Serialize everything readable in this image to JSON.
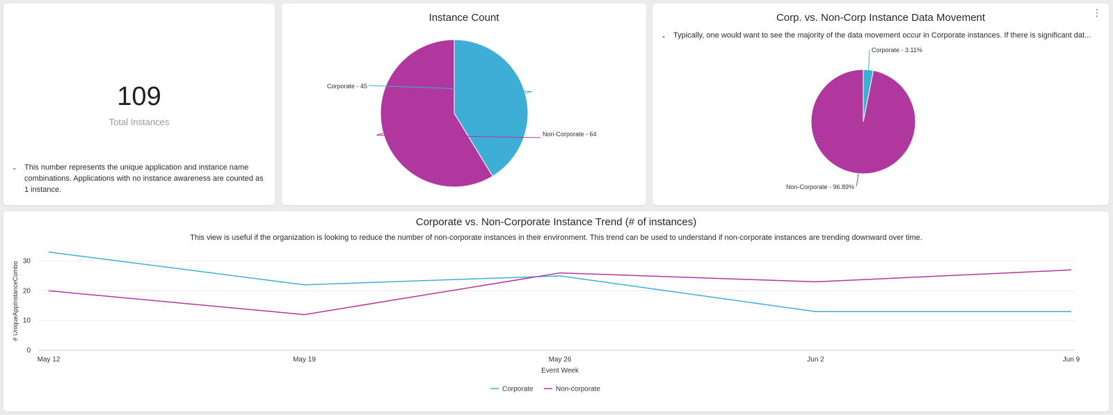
{
  "kpi": {
    "value": "109",
    "label": "Total Instances",
    "note": "This number represents the unique application and instance name combinations. Applications with no instance awareness are counted as 1 instance."
  },
  "instance_count": {
    "title": "Instance Count",
    "labels": [
      "Corporate - 45",
      "Non-Corporate - 64"
    ]
  },
  "data_movement": {
    "title": "Corp. vs. Non-Corp Instance Data Movement",
    "note": "Typically, one would want to see the majority of the data movement occur in Corporate instances. If there is significant dat...",
    "labels": [
      "Corporate - 3.11%",
      "Non-Corporate - 96.89%"
    ]
  },
  "trend": {
    "title": "Corporate vs. Non-Corporate Instance Trend (# of instances)",
    "subtitle": "This view is useful if the organization is looking to reduce the number of non-corporate instances in their environment. This trend can be used to understand if non-corporate instances are trending downward over time."
  },
  "colors": {
    "corporate": "#3eaed6",
    "non_corporate": "#b0379e"
  },
  "chart_data": [
    {
      "type": "pie",
      "title": "Instance Count",
      "categories": [
        "Corporate",
        "Non-Corporate"
      ],
      "values": [
        45,
        64
      ],
      "data_labels": [
        "Corporate - 45",
        "Non-Corporate - 64"
      ]
    },
    {
      "type": "pie",
      "title": "Corp. vs. Non-Corp Instance Data Movement",
      "categories": [
        "Corporate",
        "Non-Corporate"
      ],
      "values": [
        3.11,
        96.89
      ],
      "data_labels": [
        "Corporate - 3.11%",
        "Non-Corporate - 96.89%"
      ]
    },
    {
      "type": "line",
      "title": "Corporate vs. Non-Corporate Instance Trend (# of instances)",
      "xlabel": "Event Week",
      "ylabel": "# UniqueAppInstanceCombo",
      "categories": [
        "May 12",
        "May 19",
        "May 26",
        "Jun 2",
        "Jun 9"
      ],
      "ylim": [
        0,
        35
      ],
      "yticks": [
        0,
        10,
        20,
        30
      ],
      "grid": true,
      "legend": "bottom-center",
      "series": [
        {
          "name": "Corporate",
          "values": [
            33,
            22,
            25,
            13,
            13
          ]
        },
        {
          "name": "Non-corporate",
          "values": [
            20,
            12,
            26,
            23,
            27
          ]
        }
      ]
    }
  ]
}
